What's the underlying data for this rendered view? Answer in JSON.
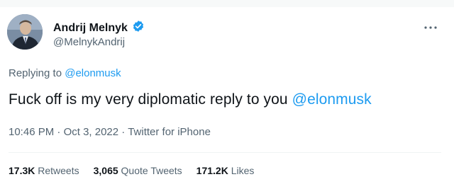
{
  "user": {
    "name": "Andrij Melnyk",
    "handle": "@MelnykAndrij",
    "verified_badge_icon": "verified-badge-icon"
  },
  "reply": {
    "prefix": "Replying to ",
    "target": "@elonmusk"
  },
  "tweet": {
    "text_main": "Fuck off is my very diplomatic reply to you ",
    "text_mention": "@elonmusk"
  },
  "meta": {
    "time": "10:46 PM",
    "separator1": " · ",
    "date": "Oct 3, 2022",
    "separator2": " · ",
    "source": "Twitter for iPhone"
  },
  "stats": {
    "retweets_count": "17.3K",
    "retweets_label": " Retweets",
    "quotes_count": "3,065",
    "quotes_label": " Quote Tweets",
    "likes_count": "171.2K",
    "likes_label": " Likes"
  },
  "colors": {
    "accent": "#1d9bf0",
    "secondary_text": "#536471",
    "primary_text": "#0f1419"
  },
  "icons": [
    "verified-badge-icon",
    "more-options-icon"
  ]
}
